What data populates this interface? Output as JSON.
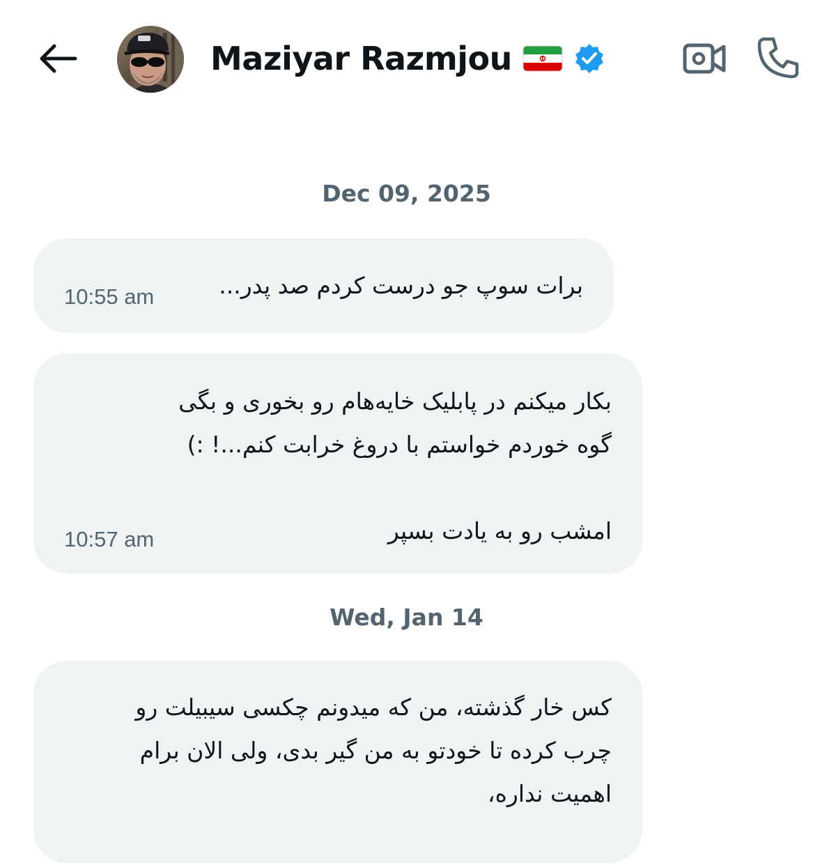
{
  "header": {
    "contact_name": "Maziyar Razmjou",
    "flag_label": "🇮🇷",
    "verified": true,
    "accent_color": "#1d9bf0",
    "back_icon": "arrow-left-icon",
    "video_icon": "video-camera-icon",
    "phone_icon": "phone-icon"
  },
  "conversation": {
    "groups": [
      {
        "date": "Dec 09, 2025",
        "messages": [
          {
            "text": "برات سوپ جو درست کردم صد پدر...",
            "time": "10:55 am"
          },
          {
            "text": "بکار میکنم در پابلیک خایه‌هام رو بخوری و بگی\nگوه خوردم خواستم با دروغ خرابت کنم...! :)\n\nامشب رو به یادت بسپر",
            "time": "10:57 am"
          }
        ]
      },
      {
        "date": "Wed, Jan 14",
        "messages": [
          {
            "text": "کس خار گذشته، من که میدونم چکسی سیبیلت رو\nچرب کرده تا خودتو به من گیر بدی، ولی الان برام\nاهمیت نداره،",
            "time": ""
          }
        ]
      }
    ]
  }
}
